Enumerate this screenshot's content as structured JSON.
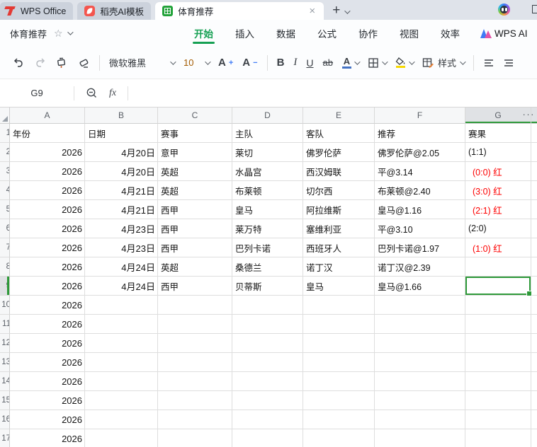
{
  "tabbar": {
    "tabs": [
      {
        "label": "WPS Office"
      },
      {
        "label": "稻壳AI模板"
      },
      {
        "label": "体育推荐"
      }
    ],
    "close_label": "×",
    "new_tab_label": "+"
  },
  "menubar": {
    "doc_title": "体育推荐",
    "star_icon": "☆",
    "items": [
      "开始",
      "插入",
      "数据",
      "公式",
      "协作",
      "视图",
      "效率"
    ],
    "active_item": "开始",
    "wps_ai_label": "WPS AI"
  },
  "toolbar": {
    "font_name": "微软雅黑",
    "font_size": "10",
    "grow_font": "A",
    "shrink_font": "A",
    "bold": "B",
    "italic": "I",
    "underline": "U",
    "strikethrough": "ab",
    "font_color_letter": "A",
    "font_color": "#4472c4",
    "fill_color": "#f7d800",
    "style_label": "样式"
  },
  "formula_bar": {
    "name_box": "G9",
    "fx_label": "fx"
  },
  "grid": {
    "col_letters": [
      "A",
      "B",
      "C",
      "D",
      "E",
      "F",
      "G"
    ],
    "selected_col": "G",
    "more_cols_indicator": "···",
    "active_cell": "G9",
    "rows": [
      {
        "n": "1",
        "header": true,
        "cells": [
          "年份",
          "日期",
          "赛事",
          "主队",
          "客队",
          "推荐",
          "赛果"
        ]
      },
      {
        "n": "2",
        "red": false,
        "cells": [
          "2026",
          "4月20日",
          "意甲",
          "莱切",
          "佛罗伦萨",
          "佛罗伦萨@2.05",
          "(1:1)"
        ]
      },
      {
        "n": "3",
        "red": true,
        "cells": [
          "2026",
          "4月20日",
          "英超",
          "水晶宫",
          "西汉姆联",
          "平@3.14",
          "(0:0) 红"
        ]
      },
      {
        "n": "4",
        "red": true,
        "cells": [
          "2026",
          "4月21日",
          "英超",
          "布莱顿",
          "切尔西",
          "布莱顿@2.40",
          "(3:0) 红"
        ]
      },
      {
        "n": "5",
        "red": true,
        "cells": [
          "2026",
          "4月21日",
          "西甲",
          "皇马",
          "阿拉维斯",
          "皇马@1.16",
          "(2:1) 红"
        ]
      },
      {
        "n": "6",
        "red": false,
        "cells": [
          "2026",
          "4月23日",
          "西甲",
          "莱万特",
          "塞维利亚",
          "平@3.10",
          "(2:0)"
        ]
      },
      {
        "n": "7",
        "red": true,
        "cells": [
          "2026",
          "4月23日",
          "西甲",
          "巴列卡诺",
          "西班牙人",
          "巴列卡诺@1.97",
          "(1:0) 红"
        ]
      },
      {
        "n": "8",
        "red": false,
        "cells": [
          "2026",
          "4月24日",
          "英超",
          "桑德兰",
          "诺丁汉",
          "诺丁汉@2.39",
          ""
        ]
      },
      {
        "n": "9",
        "active": true,
        "cells": [
          "2026",
          "4月24日",
          "西甲",
          "贝蒂斯",
          "皇马",
          "皇马@1.66",
          ""
        ]
      },
      {
        "n": "10",
        "cells": [
          "2026",
          "",
          "",
          "",
          "",
          "",
          ""
        ]
      },
      {
        "n": "11",
        "cells": [
          "2026",
          "",
          "",
          "",
          "",
          "",
          ""
        ]
      },
      {
        "n": "12",
        "cells": [
          "2026",
          "",
          "",
          "",
          "",
          "",
          ""
        ]
      },
      {
        "n": "13",
        "cells": [
          "2026",
          "",
          "",
          "",
          "",
          "",
          ""
        ]
      },
      {
        "n": "14",
        "cells": [
          "2026",
          "",
          "",
          "",
          "",
          "",
          ""
        ]
      },
      {
        "n": "15",
        "cells": [
          "2026",
          "",
          "",
          "",
          "",
          "",
          ""
        ]
      },
      {
        "n": "16",
        "cells": [
          "2026",
          "",
          "",
          "",
          "",
          "",
          ""
        ]
      },
      {
        "n": "17",
        "cells": [
          "2026",
          "",
          "",
          "",
          "",
          "",
          ""
        ]
      }
    ]
  },
  "colors": {
    "accent_green": "#16a053",
    "selection_green": "#2e9939",
    "result_red": "#fe0000",
    "sheet_icon_green": "#23a33a",
    "docer_icon_red": "#f4554e"
  }
}
